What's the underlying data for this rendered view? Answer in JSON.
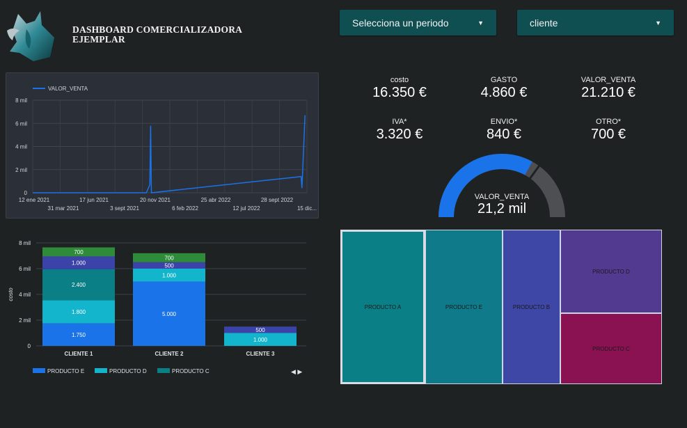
{
  "header": {
    "title": "DASHBOARD COMERCIALIZADORA EJEMPLAR",
    "logo_icon": "fox-logo-icon"
  },
  "filters": {
    "period_label": "Selecciona un periodo",
    "client_label": "cliente",
    "arrow_icon": "caret-down-icon"
  },
  "kpis": [
    {
      "label": "costo",
      "value": "16.350 €"
    },
    {
      "label": "GASTO",
      "value": "4.860 €"
    },
    {
      "label": "VALOR_VENTA",
      "value": "21.210 €"
    },
    {
      "label": "IVA*",
      "value": "3.320 €"
    },
    {
      "label": "ENVIO*",
      "value": "840 €"
    },
    {
      "label": "OTRO*",
      "value": "700 €"
    }
  ],
  "gauge": {
    "label": "VALOR_VENTA",
    "value": "21,2 mil",
    "fraction": 0.66,
    "target_fraction": 0.7
  },
  "colors": {
    "accent": "#1a73e8",
    "producto_e": "#1a73e8",
    "producto_d": "#12b5cb",
    "producto_c": "#0b7f86",
    "blue_dark": "#3c43a8",
    "green": "#2e8b3a",
    "gauge_rest": "#4d4f52"
  },
  "chart_data": [
    {
      "type": "line",
      "legend": [
        "VALOR_VENTA"
      ],
      "x_ticks_upper": [
        "12 ene 2021",
        "17 jun 2021",
        "20 nov 2021",
        "25 abr 2022",
        "28 sept 2022"
      ],
      "x_ticks_lower": [
        "31 mar 2021",
        "3 sept 2021",
        "6 feb 2022",
        "12 jul 2022",
        "15 dic..."
      ],
      "y_ticks": [
        "0",
        "2 mil",
        "4 mil",
        "6 mil",
        "8 mil"
      ],
      "ylim": [
        0,
        8000
      ],
      "x": [
        "2021-01-12",
        "2021-11-01",
        "2021-11-10",
        "2021-11-12",
        "2021-11-14",
        "2022-12-05",
        "2022-12-07",
        "2022-12-15"
      ],
      "series": [
        {
          "name": "VALOR_VENTA",
          "values": [
            0,
            0,
            700,
            5800,
            0,
            1400,
            400,
            6700
          ]
        }
      ],
      "grid": true,
      "legend_position": "top-left"
    },
    {
      "type": "bar",
      "stacked": true,
      "categories": [
        "CLIENTE 1",
        "CLIENTE 2",
        "CLIENTE 3"
      ],
      "ylabel": "costo",
      "y_ticks": [
        "0",
        "2 mil",
        "4 mil",
        "6 mil",
        "8 mil"
      ],
      "ylim": [
        0,
        8000
      ],
      "series": [
        {
          "name": "PRODUCTO E",
          "color": "#1a73e8",
          "values": [
            1750,
            5000,
            0
          ]
        },
        {
          "name": "PRODUCTO D",
          "color": "#12b5cb",
          "values": [
            1800,
            1000,
            1000
          ]
        },
        {
          "name": "PRODUCTO C",
          "color": "#0b7f86",
          "values": [
            2400,
            0,
            0
          ]
        },
        {
          "name": "",
          "color": "#3c43a8",
          "values": [
            1000,
            500,
            500
          ]
        },
        {
          "name": "",
          "color": "#2e8b3a",
          "values": [
            700,
            700,
            0
          ]
        }
      ],
      "data_labels": [
        [
          "1.750",
          "1.800",
          "2.400",
          "1.000",
          "700"
        ],
        [
          "5.000",
          "1.000",
          "",
          "500",
          "700"
        ],
        [
          "",
          "1.000",
          "",
          "500",
          ""
        ]
      ],
      "legend": [
        "PRODUCTO E",
        "PRODUCTO D",
        "PRODUCTO C"
      ],
      "legend_position": "bottom",
      "pager_icon": "◀ ▶"
    },
    {
      "type": "treemap",
      "items": [
        {
          "label": "PRODUCTO A",
          "color": "#0b7f86"
        },
        {
          "label": "PRODUCTO E",
          "color": "#0e7a8a"
        },
        {
          "label": "PRODUCTO B",
          "color": "#3e46a6"
        },
        {
          "label": "PRODUCTO D",
          "color": "#513a8f"
        },
        {
          "label": "PRODUCTO C",
          "color": "#8a1152"
        }
      ]
    }
  ]
}
